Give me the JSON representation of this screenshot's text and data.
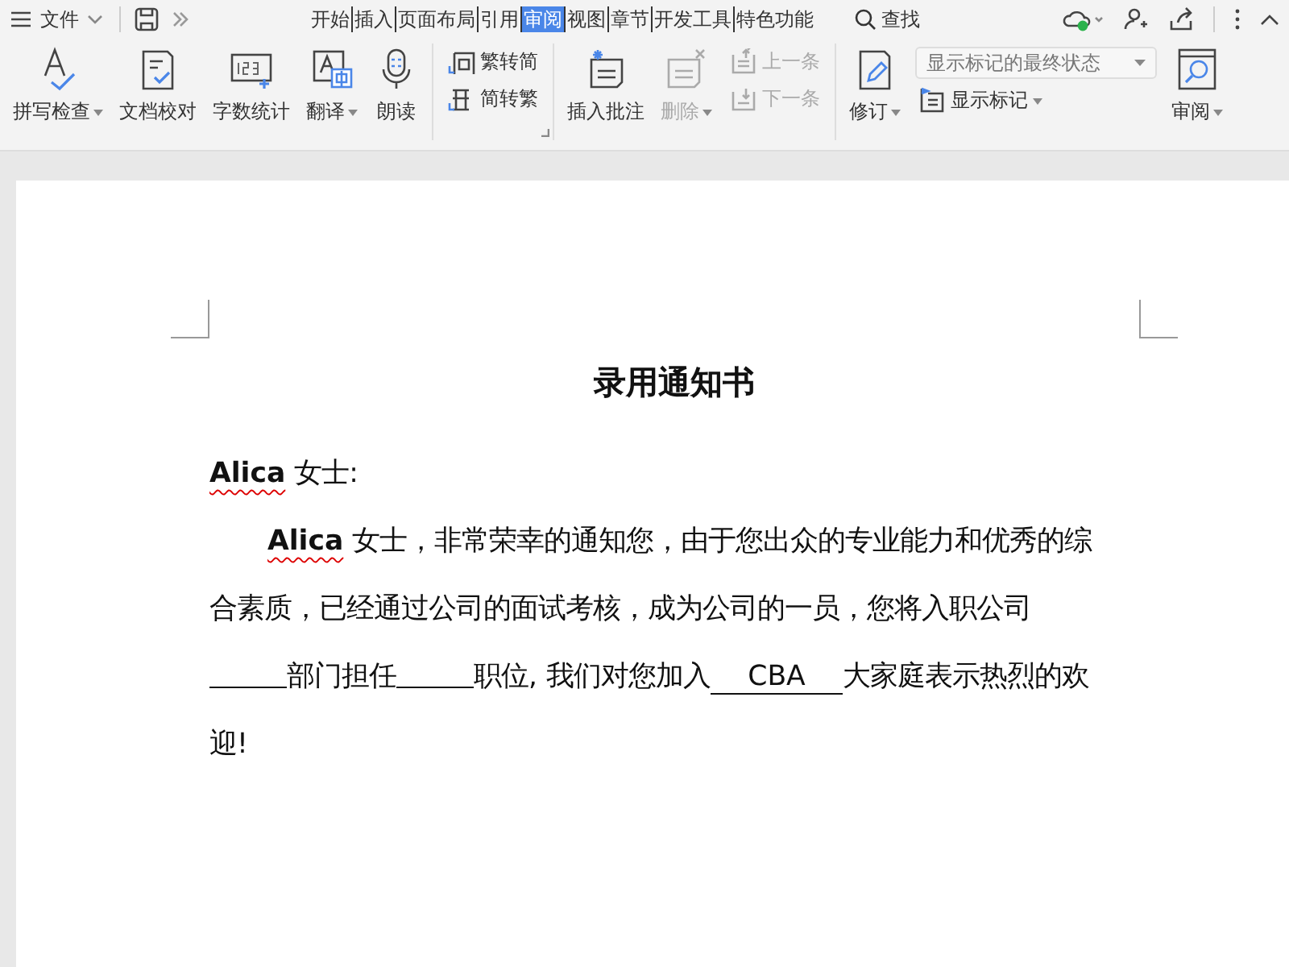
{
  "title_bar": {
    "menu_label": "文件",
    "tabs": [
      {
        "label": "开始",
        "selected": false
      },
      {
        "label": "插入",
        "selected": false
      },
      {
        "label": "页面布局",
        "selected": false
      },
      {
        "label": "引用",
        "selected": false
      },
      {
        "label": "审阅",
        "selected": true
      },
      {
        "label": "视图",
        "selected": false
      },
      {
        "label": "章节",
        "selected": false
      },
      {
        "label": "开发工具",
        "selected": false
      },
      {
        "label": "特色功能",
        "selected": false
      }
    ],
    "search_label": "查找"
  },
  "ribbon": {
    "groups": [
      {
        "items": [
          {
            "kind": "large",
            "label": "拼写检查",
            "dropdown": true,
            "disabled": false
          },
          {
            "kind": "large",
            "label": "文档校对",
            "dropdown": false,
            "disabled": false
          },
          {
            "kind": "large",
            "label": "字数统计",
            "dropdown": false,
            "disabled": false
          },
          {
            "kind": "large",
            "label": "翻译",
            "dropdown": true,
            "disabled": false
          },
          {
            "kind": "large",
            "label": "朗读",
            "dropdown": false,
            "disabled": false
          }
        ]
      },
      {
        "items": [
          {
            "kind": "small",
            "label": "繁转简",
            "dropdown": false,
            "disabled": false
          },
          {
            "kind": "small",
            "label": "简转繁",
            "dropdown": false,
            "disabled": false
          }
        ]
      },
      {
        "items": [
          {
            "kind": "large",
            "label": "插入批注",
            "dropdown": false,
            "disabled": false
          },
          {
            "kind": "large",
            "label": "删除",
            "dropdown": true,
            "disabled": true
          },
          {
            "kind": "small",
            "label": "上一条",
            "dropdown": false,
            "disabled": true
          },
          {
            "kind": "small",
            "label": "下一条",
            "dropdown": false,
            "disabled": true
          }
        ]
      },
      {
        "items": [
          {
            "kind": "large",
            "label": "修订",
            "dropdown": true,
            "disabled": false
          },
          {
            "kind": "combo",
            "value": "显示标记的最终状态"
          },
          {
            "kind": "small",
            "label": "显示标记",
            "dropdown": true,
            "disabled": false
          },
          {
            "kind": "large",
            "label": "审阅",
            "dropdown": true,
            "disabled": false
          }
        ]
      }
    ]
  },
  "document": {
    "title": "录用通知书",
    "greeting": [
      {
        "kind": "misspelled",
        "text": "Alica"
      },
      {
        "kind": "text",
        "text": " 女士:"
      }
    ],
    "body": [
      {
        "kind": "misspelled",
        "text": "Alica"
      },
      {
        "kind": "text",
        "text": " 女士，非常荣幸的通知您，由于您出众的专业能力和优秀的综合素质，已经通过公司的面试考核，成为公司的一员，您将入职公司"
      },
      {
        "kind": "blank"
      },
      {
        "kind": "text",
        "text": "部门担任"
      },
      {
        "kind": "blank"
      },
      {
        "kind": "text",
        "text": "职位, 我们对您加入"
      },
      {
        "kind": "filled",
        "text": "CBA"
      },
      {
        "kind": "text",
        "text": "大家庭表示热烈的欢迎!"
      }
    ]
  }
}
